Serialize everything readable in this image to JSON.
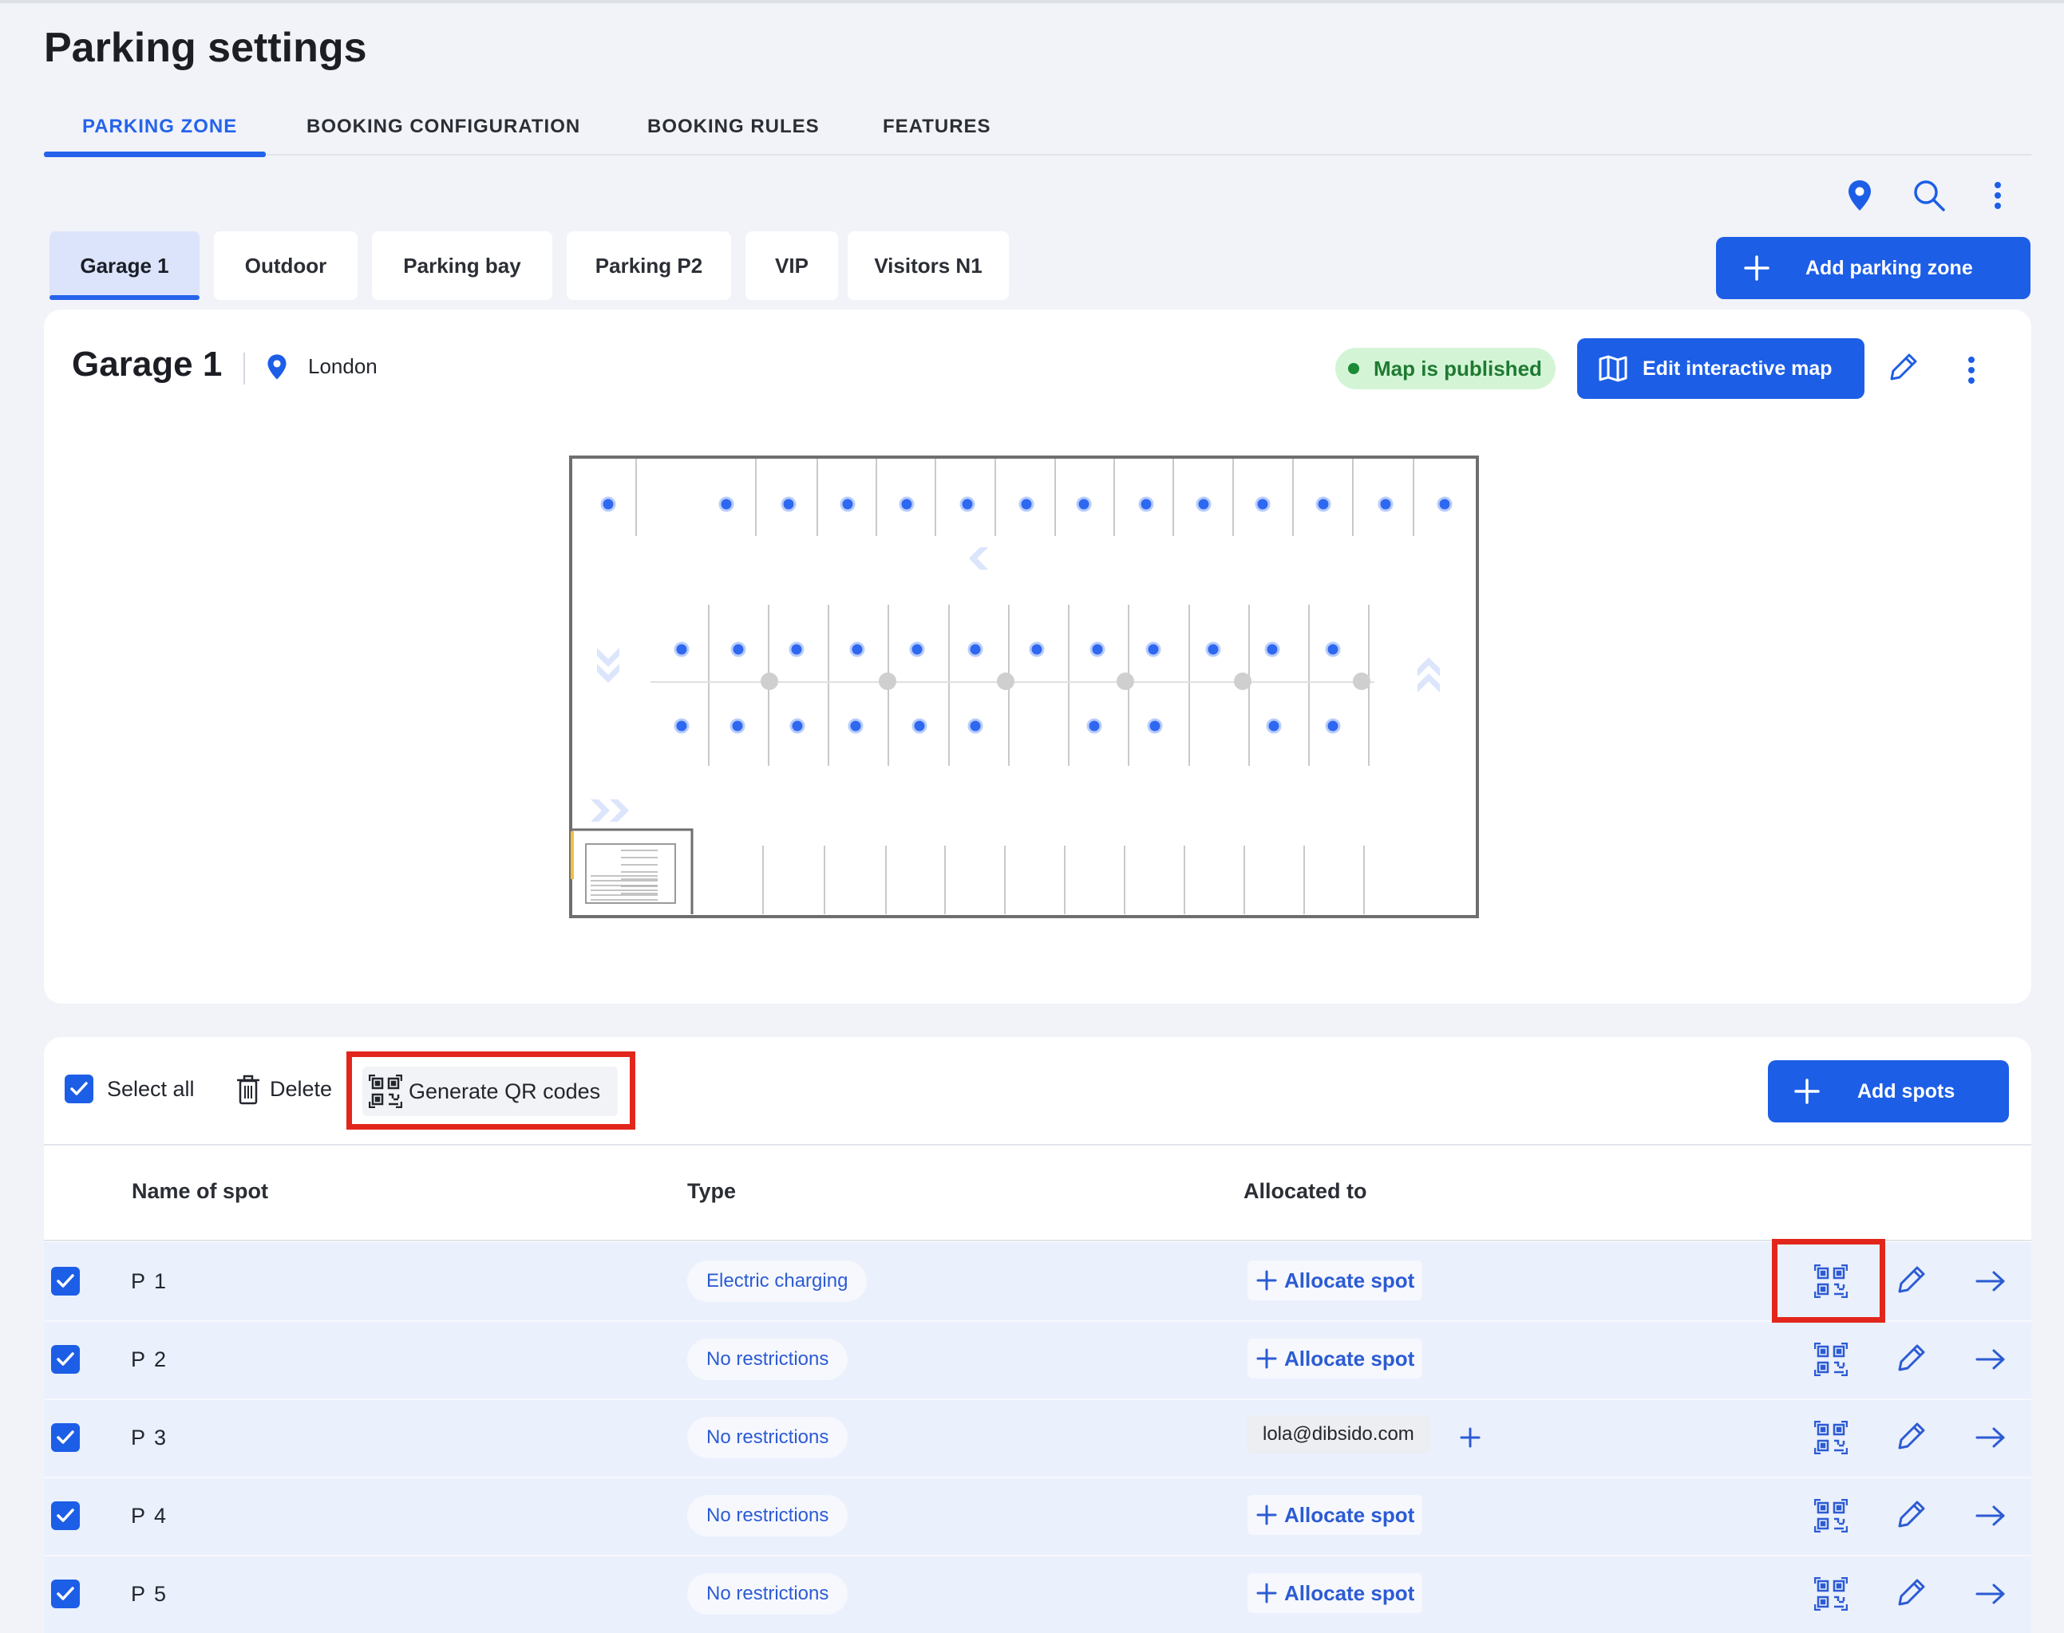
{
  "page": {
    "title": "Parking settings"
  },
  "tabs": [
    {
      "label": "PARKING ZONE",
      "active": true
    },
    {
      "label": "BOOKING CONFIGURATION",
      "active": false
    },
    {
      "label": "BOOKING RULES",
      "active": false
    },
    {
      "label": "FEATURES",
      "active": false
    }
  ],
  "toolbar_icons": [
    "location-pin-icon",
    "search-icon",
    "more-vertical-icon"
  ],
  "zones": [
    {
      "label": "Garage 1",
      "active": true
    },
    {
      "label": "Outdoor",
      "active": false
    },
    {
      "label": "Parking bay",
      "active": false
    },
    {
      "label": "Parking P2",
      "active": false
    },
    {
      "label": "VIP",
      "active": false
    },
    {
      "label": "Visitors N1",
      "active": false
    }
  ],
  "add_zone_label": "Add parking zone",
  "zone_card": {
    "name": "Garage 1",
    "location": "London",
    "status": "Map is published",
    "edit_map_label": "Edit interactive map"
  },
  "list_toolbar": {
    "select_all": "Select all",
    "delete": "Delete",
    "generate_qr": "Generate QR codes",
    "add_spots": "Add spots"
  },
  "columns": {
    "name": "Name of spot",
    "type": "Type",
    "allocated": "Allocated to"
  },
  "spots": [
    {
      "name": "P 1",
      "type": "Electric charging",
      "allocated": "Allocate spot",
      "email": null
    },
    {
      "name": "P 2",
      "type": "No restrictions",
      "allocated": "Allocate spot",
      "email": null
    },
    {
      "name": "P 3",
      "type": "No restrictions",
      "allocated": null,
      "email": "lola@dibsido.com"
    },
    {
      "name": "P 4",
      "type": "No restrictions",
      "allocated": "Allocate spot",
      "email": null
    },
    {
      "name": "P 5",
      "type": "No restrictions",
      "allocated": "Allocate spot",
      "email": null
    }
  ],
  "colors": {
    "accent": "#1d5ee6",
    "highlight_box": "#e2261c",
    "published_bg": "#d3f5d6",
    "published_text": "#1f7a31",
    "row_selected": "#eaf0fc"
  }
}
